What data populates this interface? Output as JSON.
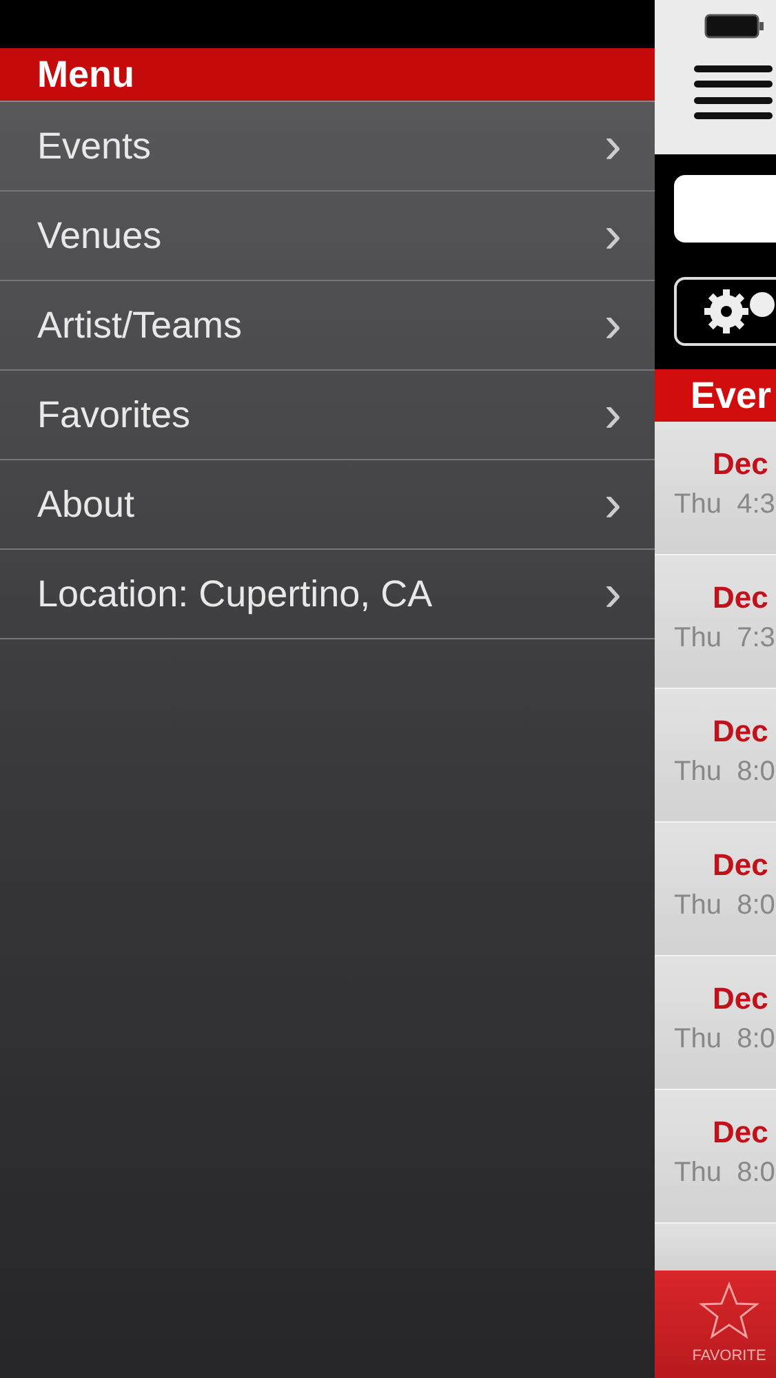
{
  "menu": {
    "title": "Menu",
    "items": [
      {
        "label": "Events",
        "chevron": "›"
      },
      {
        "label": "Venues",
        "chevron": "›"
      },
      {
        "label": "Artist/Teams",
        "chevron": "›"
      },
      {
        "label": "Favorites",
        "chevron": "›"
      },
      {
        "label": "About",
        "chevron": "›"
      },
      {
        "label": "Location: Cupertino, CA",
        "chevron": "›"
      }
    ]
  },
  "main": {
    "section_header": "Ever",
    "events": [
      {
        "date": "Dec",
        "time": "Thu  4:3"
      },
      {
        "date": "Dec",
        "time": "Thu  7:3"
      },
      {
        "date": "Dec",
        "time": "Thu  8:0"
      },
      {
        "date": "Dec",
        "time": "Thu  8:0"
      },
      {
        "date": "Dec",
        "time": "Thu  8:0"
      },
      {
        "date": "Dec",
        "time": "Thu  8:0"
      }
    ],
    "tab_bar": {
      "label": "FAVORITE"
    }
  }
}
